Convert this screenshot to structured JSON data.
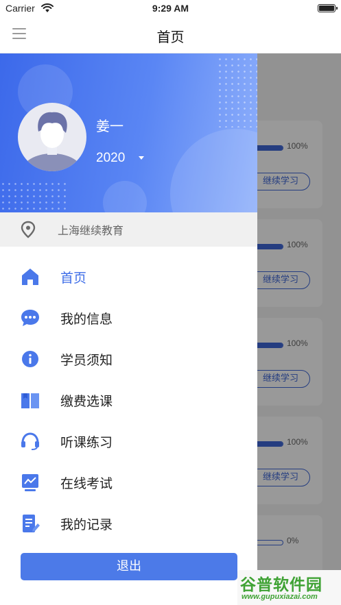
{
  "status_bar": {
    "carrier": "Carrier",
    "time": "9:29 AM"
  },
  "nav_bar": {
    "title": "首页"
  },
  "background_cards": [
    {
      "progress": "100%",
      "progress_fraction": 1.0,
      "button_label": "继续学习"
    },
    {
      "progress": "100%",
      "progress_fraction": 1.0,
      "button_label": "继续学习"
    },
    {
      "progress": "100%",
      "progress_fraction": 1.0,
      "button_label": "继续学习"
    },
    {
      "progress": "100%",
      "progress_fraction": 1.0,
      "button_label": "继续学习"
    },
    {
      "progress": "0%",
      "progress_fraction": 0.0,
      "button_label": ""
    }
  ],
  "drawer": {
    "user": {
      "name": "姜一",
      "year": "2020"
    },
    "location": {
      "label": "上海继续教育",
      "icon": "location-pin-icon"
    },
    "menu": [
      {
        "label": "首页",
        "icon": "home-icon",
        "active": true
      },
      {
        "label": "我的信息",
        "icon": "chat-bubble-icon",
        "active": false
      },
      {
        "label": "学员须知",
        "icon": "info-icon",
        "active": false
      },
      {
        "label": "缴费选课",
        "icon": "book-icon",
        "active": false
      },
      {
        "label": "听课练习",
        "icon": "headset-icon",
        "active": false
      },
      {
        "label": "在线考试",
        "icon": "chart-monitor-icon",
        "active": false
      },
      {
        "label": "我的记录",
        "icon": "record-edit-icon",
        "active": false
      }
    ],
    "logout_label": "退出"
  },
  "watermark": {
    "title": "谷普软件园",
    "url": "www.gupuxiazai.com"
  },
  "colors": {
    "accent": "#3f6ee8",
    "header_start": "#3c69ea",
    "header_end": "#8fb0fb",
    "logout": "#4c7ae8"
  }
}
